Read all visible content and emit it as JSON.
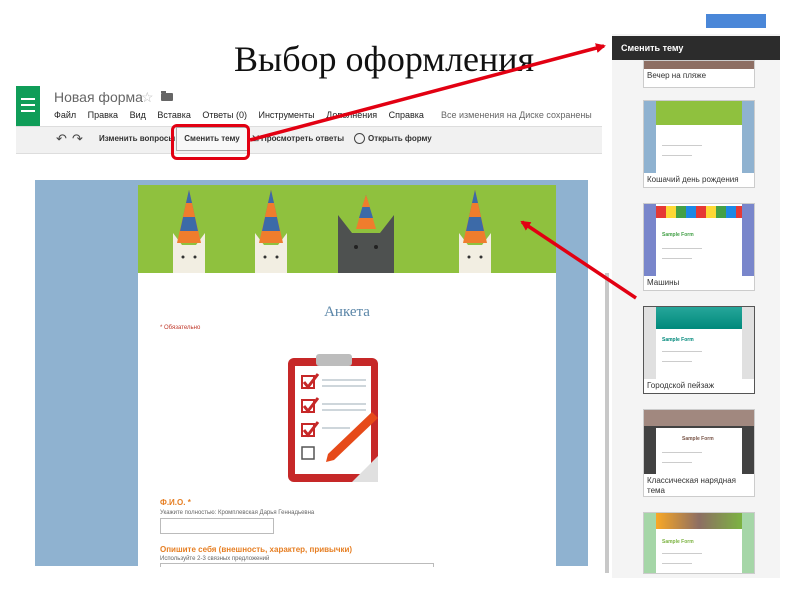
{
  "slide": {
    "title": "Выбор оформления"
  },
  "app": {
    "doc_title": "Новая форма",
    "star": "☆",
    "menu": [
      "Файл",
      "Правка",
      "Вид",
      "Вставка",
      "Ответы (0)",
      "Инструменты",
      "Дополнения",
      "Справка"
    ],
    "saved_status": "Все изменения на Диске сохранены"
  },
  "toolbar": {
    "undo": "↶",
    "redo": "↷",
    "edit_questions": "Изменить вопросы",
    "change_theme": "Сменить тему",
    "view_responses": "Просмотреть ответы",
    "open_form": "Открыть форму"
  },
  "form": {
    "title": "Анкета",
    "required_note": "* Обязательно",
    "questions": [
      {
        "label": "Ф.И.О. *",
        "help": "Укажите полностью: Кромплевская Дарья Геннадьевна"
      },
      {
        "label": "Опишите себя (внешность, характер, привычки)",
        "help": "Используйте 2-3 связных предложений"
      }
    ]
  },
  "theme_panel": {
    "header": "Сменить тему",
    "themes": [
      {
        "label": "Вечер на пляже"
      },
      {
        "label": "Кошачий день рождения"
      },
      {
        "label": "Машины",
        "sample": "Sample Form"
      },
      {
        "label": "Городской пейзаж",
        "sample": "Sample Form"
      },
      {
        "label": "Классическая нарядная тема",
        "sample": "Sample Form"
      },
      {
        "label": "",
        "sample": "Sample Form"
      }
    ]
  },
  "colors": {
    "accent_red": "#e20012",
    "banner_green": "#8fc13e",
    "canvas_blue": "#8fb2d0",
    "app_green": "#0f9d58",
    "title_blue": "#5b86a8",
    "question_orange": "#e67e22"
  }
}
